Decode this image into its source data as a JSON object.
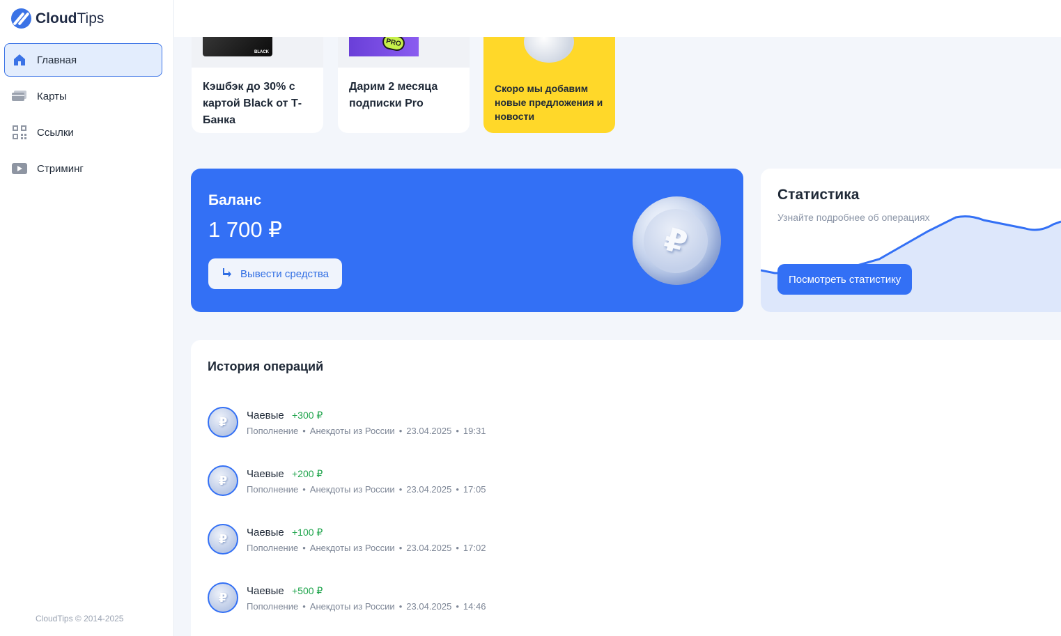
{
  "brand": {
    "name_bold": "Cloud",
    "name_light": "Tips"
  },
  "sidebar": {
    "items": [
      {
        "label": "Главная",
        "icon": "home-icon",
        "active": true
      },
      {
        "label": "Карты",
        "icon": "card-icon",
        "active": false
      },
      {
        "label": "Ссылки",
        "icon": "qr-code-icon",
        "active": false
      },
      {
        "label": "Стриминг",
        "icon": "play-icon",
        "active": false
      }
    ],
    "copyright": "CloudTips © 2014-2025"
  },
  "promos": [
    {
      "caption": "Кэшбэк до 30% с картой Black от Т-Банка",
      "card_label": "BLACK"
    },
    {
      "caption": "Дарим 2 месяца подписки Pro",
      "badge": "PRO"
    },
    {
      "caption": "Скоро мы добавим новые предложения и новости"
    }
  ],
  "balance": {
    "title": "Баланс",
    "amount": "1 700 ₽",
    "withdraw_label": "Вывести средства"
  },
  "stats": {
    "title": "Статистика",
    "subtitle": "Узнайте подробнее об операциях",
    "button_label": "Посмотреть статистику"
  },
  "history": {
    "title": "История операций",
    "transactions": [
      {
        "name": "Чаевые",
        "amount": "+300 ₽",
        "type": "Пополнение",
        "source": "Анекдоты из России",
        "date": "23.04.2025",
        "time": "19:31"
      },
      {
        "name": "Чаевые",
        "amount": "+200 ₽",
        "type": "Пополнение",
        "source": "Анекдоты из России",
        "date": "23.04.2025",
        "time": "17:05"
      },
      {
        "name": "Чаевые",
        "amount": "+100 ₽",
        "type": "Пополнение",
        "source": "Анекдоты из России",
        "date": "23.04.2025",
        "time": "17:02"
      },
      {
        "name": "Чаевые",
        "amount": "+500 ₽",
        "type": "Пополнение",
        "source": "Анекдоты из России",
        "date": "23.04.2025",
        "time": "14:46"
      }
    ]
  },
  "colors": {
    "accent": "#3370f5",
    "promo_yellow": "#ffd829",
    "positive": "#1ea44b"
  }
}
